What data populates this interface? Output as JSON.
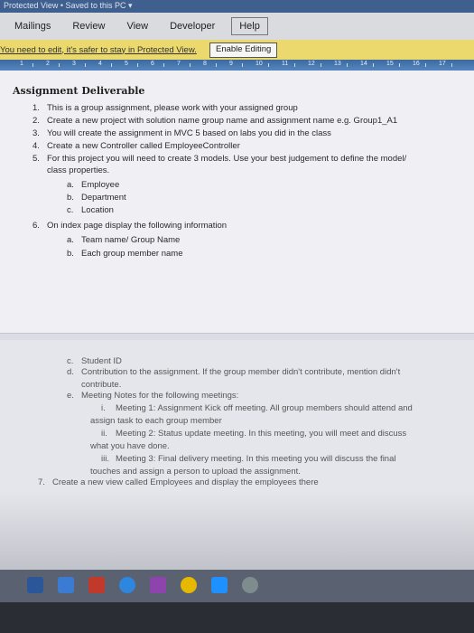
{
  "titlebar": {
    "text": "Protected View • Saved to this PC ▾"
  },
  "ribbon": {
    "tabs": [
      {
        "label": "Mailings"
      },
      {
        "label": "Review"
      },
      {
        "label": "View"
      },
      {
        "label": "Developer"
      },
      {
        "label": "Help"
      }
    ]
  },
  "message_bar": {
    "text": "You need to edit, it's safer to stay in Protected View.",
    "enable_button": "Enable Editing"
  },
  "ruler": {
    "numbers": [
      "1",
      "2",
      "3",
      "4",
      "5",
      "6",
      "7",
      "8",
      "9",
      "10",
      "11",
      "12",
      "13",
      "14",
      "15",
      "16",
      "17"
    ]
  },
  "document": {
    "heading": "Assignment Deliverable",
    "items": [
      {
        "n": "1.",
        "text": "This is a group assignment, please work with your assigned group"
      },
      {
        "n": "2.",
        "text": "Create a new project with solution name group name and assignment name e.g. Group1_A1"
      },
      {
        "n": "3.",
        "text": "You will create the assignment in MVC 5 based on labs you did in the class"
      },
      {
        "n": "4.",
        "text": "Create a new Controller called EmployeeController"
      },
      {
        "n": "5.",
        "text": "For this project you will need to create 3 models. Use your best judgement to define the model/"
      },
      {
        "n": "",
        "text": "class properties."
      },
      {
        "n": "a.",
        "text": "Employee"
      },
      {
        "n": "b.",
        "text": "Department"
      },
      {
        "n": "c.",
        "text": "Location"
      },
      {
        "n": "6.",
        "text": "On index page display the following information"
      },
      {
        "n": "a.",
        "text": "Team name/ Group Name"
      },
      {
        "n": "b.",
        "text": "Each group member name"
      }
    ],
    "items2": [
      {
        "n": "c.",
        "text": "Student ID"
      },
      {
        "n": "d.",
        "text": "Contribution to the assignment. If the group member didn't contribute, mention didn't"
      },
      {
        "n": "",
        "text": "contribute."
      },
      {
        "n": "e.",
        "text": "Meeting Notes for the following meetings:"
      },
      {
        "n": "i.",
        "text": "Meeting 1: Assignment Kick off meeting. All group members should attend and"
      },
      {
        "n": "",
        "text": "assign task to each group member"
      },
      {
        "n": "ii.",
        "text": "Meeting 2: Status update meeting. In this meeting, you will meet and discuss"
      },
      {
        "n": "",
        "text": "what you have done."
      },
      {
        "n": "iii.",
        "text": "Meeting 3: Final delivery meeting. In this meeting you will discuss the final"
      },
      {
        "n": "",
        "text": "touches and assign a person to upload the assignment."
      },
      {
        "n": "7.",
        "text": "Create a new view called Employees and display the employees there"
      }
    ]
  },
  "taskbar": {
    "icons": [
      "word-icon",
      "start-icon",
      "photos-icon",
      "edge-icon",
      "media-icon",
      "chrome-icon",
      "store-icon",
      "settings-icon"
    ]
  }
}
